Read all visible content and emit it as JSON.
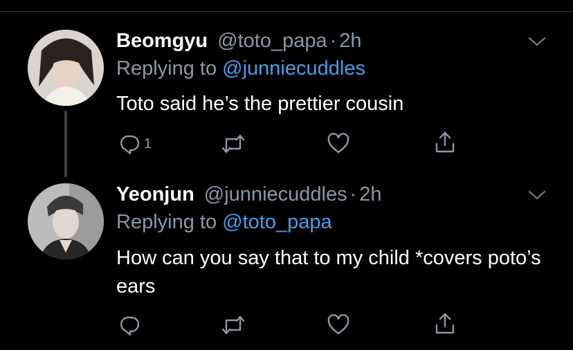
{
  "tweets": [
    {
      "name": "Beomgyu",
      "handle": "@toto_papa",
      "separator": "·",
      "time": "2h",
      "replying_prefix": "Replying to",
      "replying_to": "@junniecuddles",
      "text": "Toto said he’s the prettier cousin",
      "reply_count": "1"
    },
    {
      "name": "Yeonjun",
      "handle": "@junniecuddles",
      "separator": "·",
      "time": "2h",
      "replying_prefix": "Replying to",
      "replying_to": "@toto_papa",
      "text": "How can you say that to my child *covers poto’s ears",
      "reply_count": ""
    }
  ],
  "icons": {
    "reply": "reply-icon",
    "retweet": "retweet-icon",
    "like": "heart-icon",
    "share": "share-icon",
    "more": "chevron-down-icon"
  },
  "colors": {
    "background": "#000000",
    "text": "#ffffff",
    "muted": "#8b98a5",
    "link": "#4a9ee8"
  }
}
